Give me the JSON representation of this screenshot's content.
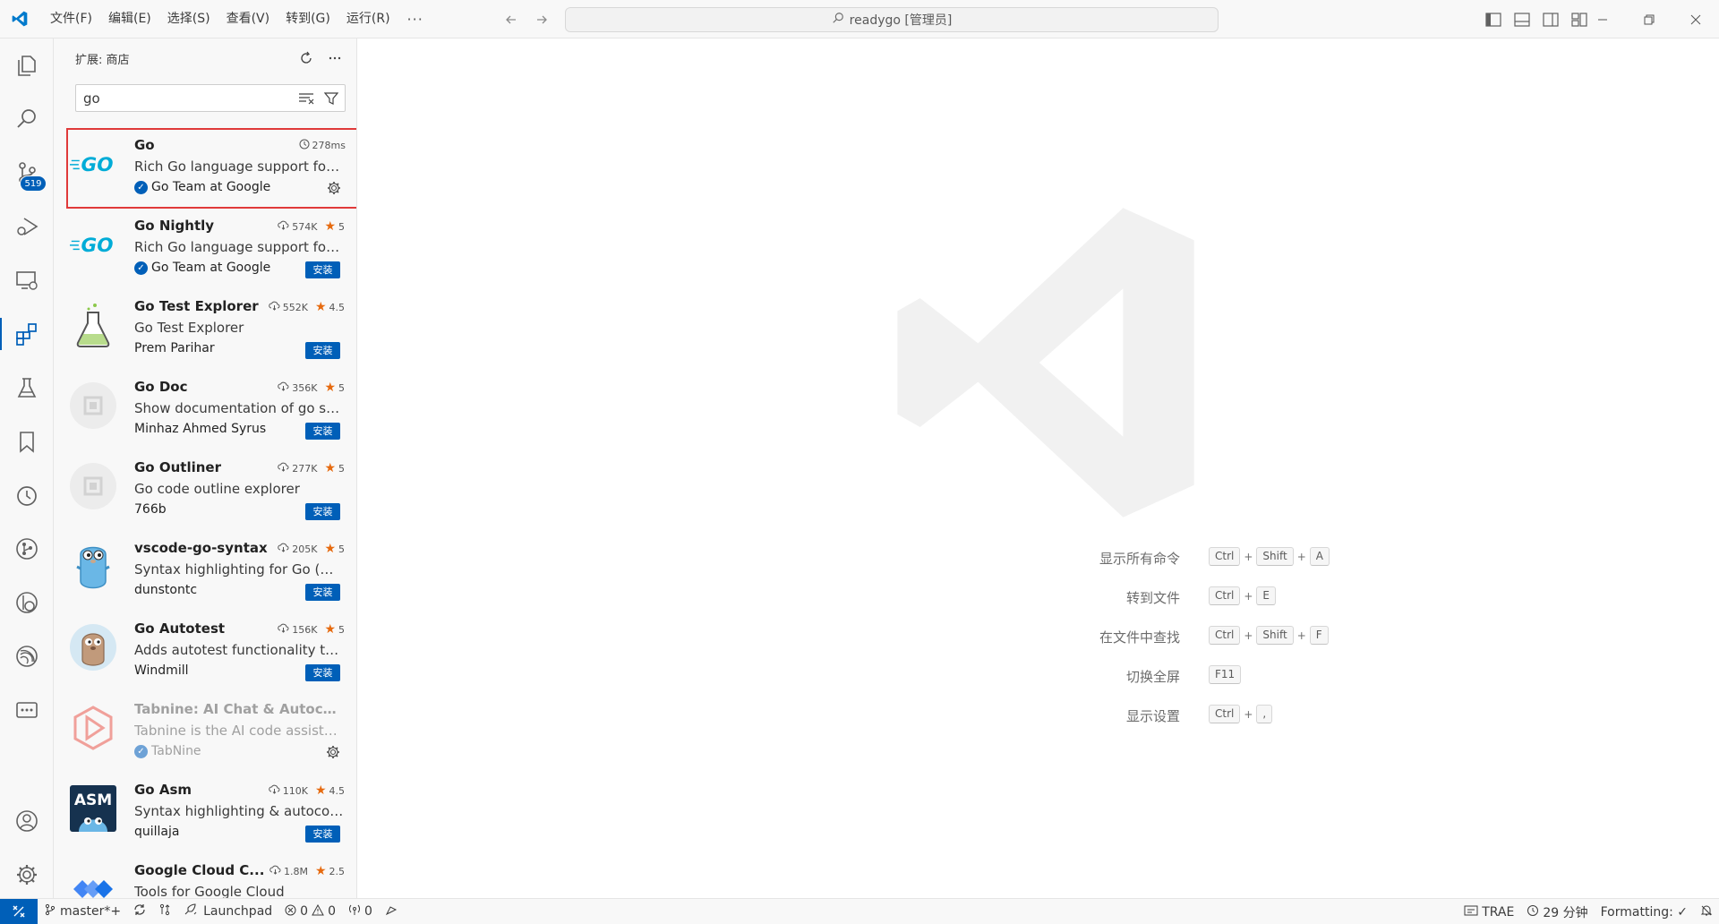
{
  "menu": [
    "文件(F)",
    "编辑(E)",
    "选择(S)",
    "查看(V)",
    "转到(G)",
    "运行(R)"
  ],
  "menu_more": "···",
  "command_center": "readygo [管理员]",
  "activity_badge": "519",
  "sidebar": {
    "title": "扩展: 商店",
    "search_value": "go"
  },
  "extensions": [
    {
      "name": "Go",
      "desc": "Rich Go language support for ...",
      "publisher": "Go Team at Google",
      "verified": "✓",
      "stat": "278ms"
    },
    {
      "name": "Go Nightly",
      "desc": "Rich Go language support for ...",
      "publisher": "Go Team at Google",
      "verified": "✓",
      "downloads": "574K",
      "rating": "5",
      "install": "安装"
    },
    {
      "name": "Go Test Explorer",
      "desc": "Go Test Explorer",
      "publisher": "Prem Parihar",
      "downloads": "552K",
      "rating": "4.5",
      "install": "安装"
    },
    {
      "name": "Go Doc",
      "desc": "Show documentation of go sy...",
      "publisher": "Minhaz Ahmed Syrus",
      "downloads": "356K",
      "rating": "5",
      "install": "安装"
    },
    {
      "name": "Go Outliner",
      "desc": "Go code outline explorer",
      "publisher": "766b",
      "downloads": "277K",
      "rating": "5",
      "install": "安装"
    },
    {
      "name": "vscode-go-syntax",
      "desc": "Syntax highlighting for Go (WIP)",
      "publisher": "dunstontc",
      "downloads": "205K",
      "rating": "5",
      "install": "安装"
    },
    {
      "name": "Go Autotest",
      "desc": "Adds autotest functionality to ...",
      "publisher": "Windmill",
      "downloads": "156K",
      "rating": "5",
      "install": "安装"
    },
    {
      "name": "Tabnine: AI Chat & Autocom...",
      "desc": "Tabnine is the AI code assistant...",
      "publisher": "TabNine",
      "verified": "✓"
    },
    {
      "name": "Go Asm",
      "desc": "Syntax highlighting & autocom...",
      "publisher": "quillaja",
      "downloads": "110K",
      "rating": "4.5",
      "install": "安装",
      "icon_text": "ASM"
    },
    {
      "name": "Google Cloud C...",
      "desc": "Tools for Google Cloud",
      "downloads": "1.8M",
      "rating": "2.5"
    }
  ],
  "go_logo_text": "GO",
  "shortcuts": [
    {
      "label": "显示所有命令",
      "keys": [
        "Ctrl",
        "Shift",
        "A"
      ]
    },
    {
      "label": "转到文件",
      "keys": [
        "Ctrl",
        "E"
      ]
    },
    {
      "label": "在文件中查找",
      "keys": [
        "Ctrl",
        "Shift",
        "F"
      ]
    },
    {
      "label": "切换全屏",
      "keys": [
        "F11"
      ]
    },
    {
      "label": "显示设置",
      "keys": [
        "Ctrl",
        ","
      ]
    }
  ],
  "status": {
    "branch": "master*+",
    "launchpad": "Launchpad",
    "errors": "0",
    "warnings": "0",
    "ports": "0",
    "trae": "TRAE",
    "time": "29 分钟",
    "formatting": "Formatting: ✓"
  },
  "colors": {
    "accent": "#005fb8",
    "star": "#e66a0f",
    "selection_outline": "#e03a3a"
  }
}
